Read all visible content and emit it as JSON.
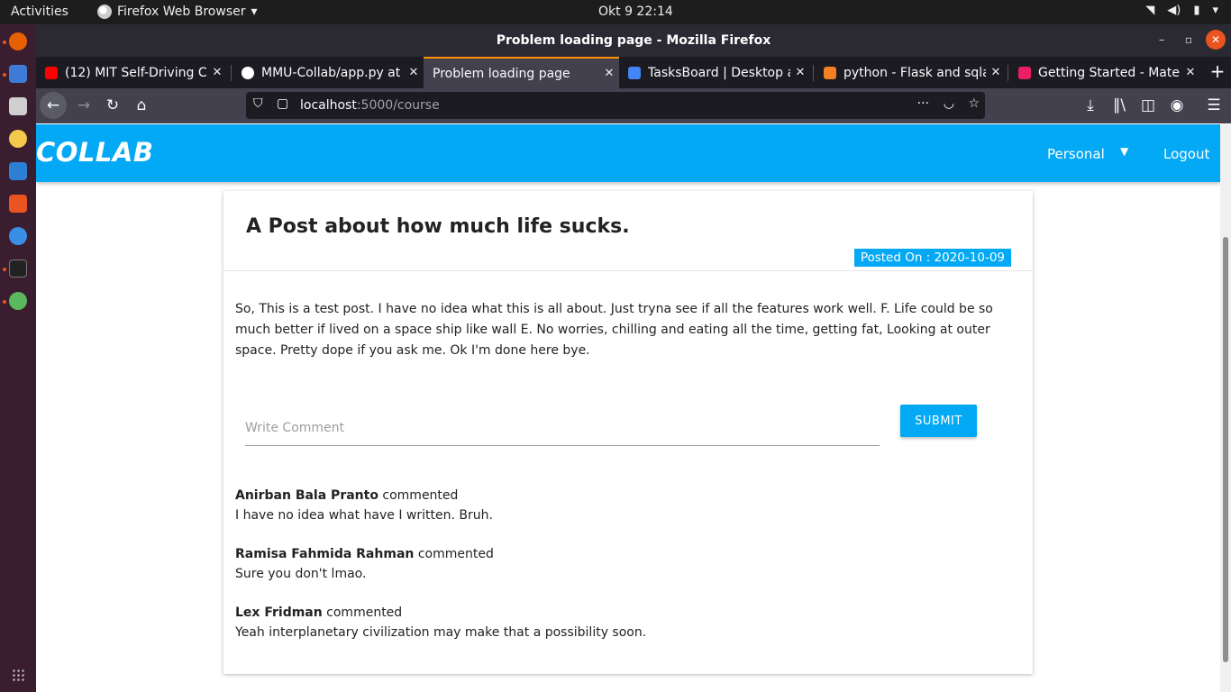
{
  "os": {
    "activities": "Activities",
    "app_menu": "Firefox Web Browser",
    "clock": "Okt 9  22:14"
  },
  "window": {
    "title": "Problem loading page - Mozilla Firefox"
  },
  "tabs": [
    {
      "label": "(12) MIT Self-Driving Ca",
      "favicon_color": "#ff0000"
    },
    {
      "label": "MMU-Collab/app.py at",
      "favicon_color": "#ffffff"
    },
    {
      "label": "Problem loading page",
      "favicon_color": "",
      "active": true
    },
    {
      "label": "TasksBoard | Desktop a",
      "favicon_color": "#4285f4"
    },
    {
      "label": "python - Flask and sqla",
      "favicon_color": "#f48024"
    },
    {
      "label": "Getting Started - Mate",
      "favicon_color": "#e91e63"
    }
  ],
  "url": {
    "host": "localhost",
    "path": ":5000/course"
  },
  "app": {
    "brand": "COLLAB",
    "nav_personal": "Personal",
    "nav_logout": "Logout",
    "accent": "#03a9f4"
  },
  "post": {
    "title": "A Post about how much life sucks.",
    "posted_on": "Posted On : 2020-10-09",
    "body": "So, This is a test post. I have no idea what this is all about. Just tryna see if all the features work well. F. Life could be so much better if lived on a space ship like wall E. No worries, chilling and eating all the time, getting fat, Looking at outer space. Pretty dope if you ask me. Ok I'm done here bye.",
    "comment_placeholder": "Write Comment",
    "submit_label": "SUBMIT"
  },
  "comments": [
    {
      "author": "Anirban Bala Pranto",
      "verb": "commented",
      "text": "I have no idea what have I written. Bruh."
    },
    {
      "author": "Ramisa Fahmida Rahman",
      "verb": "commented",
      "text": "Sure you don't lmao."
    },
    {
      "author": "Lex Fridman",
      "verb": "commented",
      "text": "Yeah interplanetary civilization may make that a possibility soon."
    }
  ]
}
